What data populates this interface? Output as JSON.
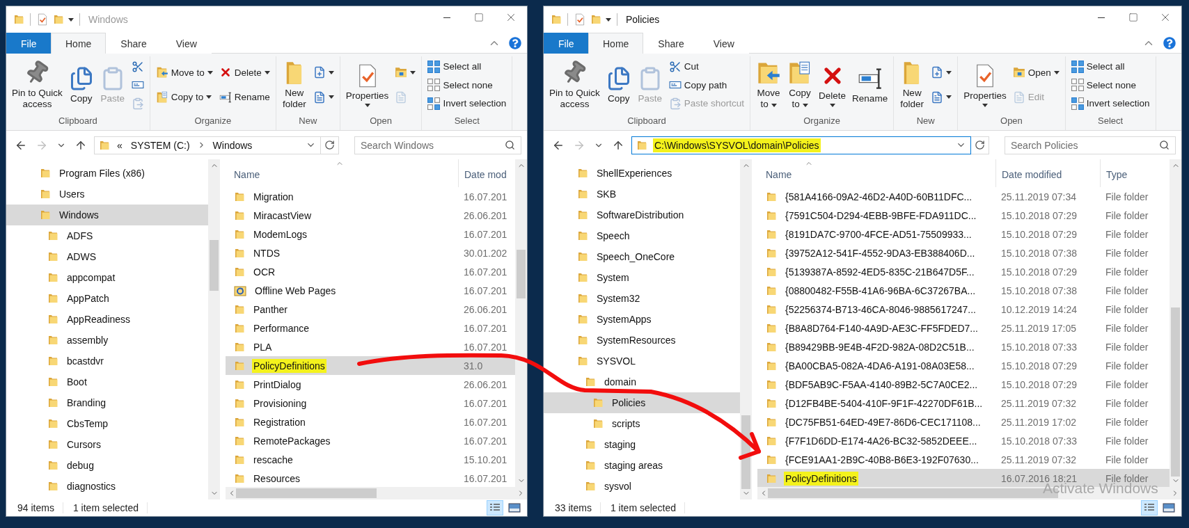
{
  "windows": [
    {
      "title": "Windows",
      "active": false,
      "tabs": [
        {
          "label": "File",
          "kind": "file",
          "selected": false
        },
        {
          "label": "Home",
          "kind": "tab",
          "selected": true
        },
        {
          "label": "Share",
          "kind": "tab",
          "selected": false
        },
        {
          "label": "View",
          "kind": "tab",
          "selected": false
        }
      ],
      "ribbon": [
        {
          "label": "Clipboard",
          "columns": [
            [
              {
                "kind": "pin",
                "label": [
                  "Pin to Quick",
                  "access"
                ],
                "dropdown": false,
                "disabled": false
              }
            ],
            [
              {
                "kind": "copy",
                "label": [
                  "Copy"
                ],
                "dropdown": false,
                "disabled": false
              }
            ],
            [
              {
                "kind": "paste",
                "label": [
                  "Paste"
                ],
                "dropdown": false,
                "disabled": true
              }
            ],
            [
              {
                "kind": "cut",
                "dropdown": false,
                "disabled": false
              },
              {
                "kind": "copypath",
                "dropdown": false,
                "disabled": false
              },
              {
                "kind": "pasteshortcut",
                "dropdown": false,
                "disabled": true
              }
            ]
          ]
        },
        {
          "label": "Organize",
          "columns": [
            [
              {
                "kind": "move",
                "label": [
                  "Move to"
                ],
                "dropdown": true,
                "disabled": false
              },
              {
                "kind": "copyto",
                "label": [
                  "Copy to"
                ],
                "dropdown": true,
                "disabled": false
              }
            ],
            [
              {
                "kind": "delete",
                "label": [
                  "Delete"
                ],
                "dropdown": true,
                "disabled": false
              },
              {
                "kind": "rename",
                "label": [
                  "Rename"
                ],
                "dropdown": false,
                "disabled": false
              }
            ]
          ]
        },
        {
          "label": "New",
          "columns": [
            [
              {
                "kind": "newfolder",
                "label": [
                  "New",
                  "folder"
                ],
                "dropdown": false,
                "disabled": false
              }
            ],
            [
              {
                "kind": "newitem",
                "dropdown": true,
                "disabled": false
              },
              {
                "kind": "easyaccess",
                "dropdown": true,
                "disabled": false
              }
            ]
          ]
        },
        {
          "label": "Open",
          "columns": [
            [
              {
                "kind": "properties",
                "label": [
                  "Properties"
                ],
                "dropdown": true,
                "disabled": false
              }
            ],
            [
              {
                "kind": "open",
                "dropdown": true,
                "disabled": false
              },
              {
                "kind": "edit",
                "dropdown": false,
                "disabled": true
              }
            ]
          ]
        },
        {
          "label": "Select",
          "columns": [
            [
              {
                "kind": "selectall",
                "label": [
                  "Select all"
                ],
                "dropdown": false,
                "disabled": false
              },
              {
                "kind": "selectnone",
                "label": [
                  "Select none"
                ],
                "dropdown": false,
                "disabled": false
              },
              {
                "kind": "invert",
                "label": [
                  "Invert selection"
                ],
                "dropdown": false,
                "disabled": false
              }
            ]
          ]
        }
      ],
      "address": {
        "focused": false,
        "overflow": "«",
        "crumbs": [
          "SYSTEM (C:)",
          "Windows"
        ]
      },
      "search": {
        "placeholder": "Search Windows"
      },
      "nav": [
        {
          "label": "Program Files (x86)",
          "selected": false
        },
        {
          "label": "Users",
          "selected": false
        },
        {
          "label": "Windows",
          "selected": true,
          "children": [
            {
              "label": "ADFS",
              "selected": false
            },
            {
              "label": "ADWS",
              "selected": false
            },
            {
              "label": "appcompat",
              "selected": false
            },
            {
              "label": "AppPatch",
              "selected": false
            },
            {
              "label": "AppReadiness",
              "selected": false
            },
            {
              "label": "assembly",
              "selected": false
            },
            {
              "label": "bcastdvr",
              "selected": false
            },
            {
              "label": "Boot",
              "selected": false
            },
            {
              "label": "Branding",
              "selected": false
            },
            {
              "label": "CbsTemp",
              "selected": false
            },
            {
              "label": "Cursors",
              "selected": false
            },
            {
              "label": "debug",
              "selected": false
            },
            {
              "label": "diagnostics",
              "selected": false
            }
          ]
        }
      ],
      "columns": [
        "Name",
        "Date mod"
      ],
      "rows": [
        {
          "name": "Migration",
          "date": "16.07.201",
          "kind": "folder",
          "selected": false,
          "highlighted": false
        },
        {
          "name": "MiracastView",
          "date": "26.06.201",
          "kind": "folder",
          "selected": false,
          "highlighted": false
        },
        {
          "name": "ModemLogs",
          "date": "16.07.201",
          "kind": "folder",
          "selected": false,
          "highlighted": false
        },
        {
          "name": "NTDS",
          "date": "30.01.202",
          "kind": "folder",
          "selected": false,
          "highlighted": false
        },
        {
          "name": "OCR",
          "date": "16.07.201",
          "kind": "folder",
          "selected": false,
          "highlighted": false
        },
        {
          "name": "Offline Web Pages",
          "date": "16.07.201",
          "kind": "special",
          "selected": false,
          "highlighted": false
        },
        {
          "name": "Panther",
          "date": "26.06.201",
          "kind": "folder",
          "selected": false,
          "highlighted": false
        },
        {
          "name": "Performance",
          "date": "16.07.201",
          "kind": "folder",
          "selected": false,
          "highlighted": false
        },
        {
          "name": "PLA",
          "date": "16.07.201",
          "kind": "folder",
          "selected": false,
          "highlighted": false
        },
        {
          "name": "PolicyDefinitions",
          "date": "31.0",
          "kind": "folder",
          "selected": true,
          "highlighted": true
        },
        {
          "name": "PrintDialog",
          "date": "26.06.201",
          "kind": "folder",
          "selected": false,
          "highlighted": false
        },
        {
          "name": "Provisioning",
          "date": "16.07.201",
          "kind": "folder",
          "selected": false,
          "highlighted": false
        },
        {
          "name": "Registration",
          "date": "16.07.201",
          "kind": "folder",
          "selected": false,
          "highlighted": false
        },
        {
          "name": "RemotePackages",
          "date": "16.07.201",
          "kind": "folder",
          "selected": false,
          "highlighted": false
        },
        {
          "name": "rescache",
          "date": "15.10.201",
          "kind": "folder",
          "selected": false,
          "highlighted": false
        },
        {
          "name": "Resources",
          "date": "16.07.201",
          "kind": "folder",
          "selected": false,
          "highlighted": false
        }
      ],
      "status": {
        "count": "94 items",
        "selection": "1 item selected"
      },
      "views": [
        {
          "kind": "details",
          "selected": true
        },
        {
          "kind": "tiles",
          "selected": false
        }
      ]
    },
    {
      "title": "Policies",
      "active": true,
      "tabs": [
        {
          "label": "File",
          "kind": "file",
          "selected": false
        },
        {
          "label": "Home",
          "kind": "tab",
          "selected": true
        },
        {
          "label": "Share",
          "kind": "tab",
          "selected": false
        },
        {
          "label": "View",
          "kind": "tab",
          "selected": false
        }
      ],
      "ribbon": [
        {
          "label": "Clipboard",
          "columns": [
            [
              {
                "kind": "pin",
                "label": [
                  "Pin to Quick",
                  "access"
                ],
                "dropdown": false,
                "disabled": false
              }
            ],
            [
              {
                "kind": "copy",
                "label": [
                  "Copy"
                ],
                "dropdown": false,
                "disabled": false
              }
            ],
            [
              {
                "kind": "paste",
                "label": [
                  "Paste"
                ],
                "dropdown": false,
                "disabled": true
              }
            ],
            [
              {
                "kind": "cut",
                "label": [
                  "Cut"
                ],
                "dropdown": false,
                "disabled": false
              },
              {
                "kind": "copypath",
                "label": [
                  "Copy path"
                ],
                "dropdown": false,
                "disabled": false
              },
              {
                "kind": "pasteshortcut",
                "label": [
                  "Paste shortcut"
                ],
                "dropdown": false,
                "disabled": true
              }
            ]
          ]
        },
        {
          "label": "Organize",
          "columns": [
            [
              {
                "kind": "move",
                "label": [
                  "Move",
                  "to"
                ],
                "dropdown": true,
                "disabled": false
              }
            ],
            [
              {
                "kind": "copyto",
                "label": [
                  "Copy",
                  "to"
                ],
                "dropdown": true,
                "disabled": false
              }
            ],
            [
              {
                "kind": "delete",
                "label": [
                  "Delete"
                ],
                "dropdown": true,
                "disabled": false
              }
            ],
            [
              {
                "kind": "rename",
                "label": [
                  "Rename"
                ],
                "dropdown": false,
                "disabled": false
              }
            ]
          ]
        },
        {
          "label": "New",
          "columns": [
            [
              {
                "kind": "newfolder",
                "label": [
                  "New",
                  "folder"
                ],
                "dropdown": false,
                "disabled": false
              }
            ],
            [
              {
                "kind": "newitem",
                "dropdown": true,
                "disabled": false
              },
              {
                "kind": "easyaccess",
                "dropdown": true,
                "disabled": false
              }
            ]
          ]
        },
        {
          "label": "Open",
          "columns": [
            [
              {
                "kind": "properties",
                "label": [
                  "Properties"
                ],
                "dropdown": true,
                "disabled": false
              }
            ],
            [
              {
                "kind": "open",
                "label": [
                  "Open"
                ],
                "dropdown": true,
                "disabled": false
              },
              {
                "kind": "edit",
                "label": [
                  "Edit"
                ],
                "dropdown": false,
                "disabled": true
              }
            ]
          ]
        },
        {
          "label": "Select",
          "columns": [
            [
              {
                "kind": "selectall",
                "label": [
                  "Select all"
                ],
                "dropdown": false,
                "disabled": false
              },
              {
                "kind": "selectnone",
                "label": [
                  "Select none"
                ],
                "dropdown": false,
                "disabled": false
              },
              {
                "kind": "invert",
                "label": [
                  "Invert selection"
                ],
                "dropdown": false,
                "disabled": false
              }
            ]
          ]
        }
      ],
      "address": {
        "focused": true,
        "path": "C:\\Windows\\SYSVOL\\domain\\Policies",
        "highlighted": true
      },
      "search": {
        "placeholder": "Search Policies"
      },
      "nav": [
        {
          "label": "ShellExperiences",
          "selected": false
        },
        {
          "label": "SKB",
          "selected": false
        },
        {
          "label": "SoftwareDistribution",
          "selected": false
        },
        {
          "label": "Speech",
          "selected": false
        },
        {
          "label": "Speech_OneCore",
          "selected": false
        },
        {
          "label": "System",
          "selected": false
        },
        {
          "label": "System32",
          "selected": false
        },
        {
          "label": "SystemApps",
          "selected": false
        },
        {
          "label": "SystemResources",
          "selected": false
        },
        {
          "label": "SYSVOL",
          "selected": false,
          "children": [
            {
              "label": "domain",
              "selected": false,
              "children": [
                {
                  "label": "Policies",
                  "selected": true
                },
                {
                  "label": "scripts",
                  "selected": false
                }
              ]
            },
            {
              "label": "staging",
              "selected": false
            },
            {
              "label": "staging areas",
              "selected": false
            },
            {
              "label": "sysvol",
              "selected": false
            }
          ]
        }
      ],
      "columns": [
        "Name",
        "Date modified",
        "Type"
      ],
      "rows": [
        {
          "name": "{581A4166-09A2-46D2-A40D-60B11DFC...",
          "date": "25.11.2019 07:34",
          "type": "File folder",
          "kind": "folder",
          "selected": false,
          "highlighted": false
        },
        {
          "name": "{7591C504-D294-4EBB-9BFE-FDA911DC...",
          "date": "15.10.2018 07:29",
          "type": "File folder",
          "kind": "folder",
          "selected": false,
          "highlighted": false
        },
        {
          "name": "{8191DA7C-9700-4FCE-AD51-75509933...",
          "date": "15.10.2018 07:29",
          "type": "File folder",
          "kind": "folder",
          "selected": false,
          "highlighted": false
        },
        {
          "name": "{39752A12-541F-4552-9DA3-EB388406D...",
          "date": "15.10.2018 07:38",
          "type": "File folder",
          "kind": "folder",
          "selected": false,
          "highlighted": false
        },
        {
          "name": "{5139387A-8592-4ED5-835C-21B647D5F...",
          "date": "15.10.2018 07:29",
          "type": "File folder",
          "kind": "folder",
          "selected": false,
          "highlighted": false
        },
        {
          "name": "{08800482-F55B-41A6-96BA-6C37267BA...",
          "date": "15.10.2018 07:38",
          "type": "File folder",
          "kind": "folder",
          "selected": false,
          "highlighted": false
        },
        {
          "name": "{52256374-B713-46CA-8046-9885617247...",
          "date": "10.12.2019 14:24",
          "type": "File folder",
          "kind": "folder",
          "selected": false,
          "highlighted": false
        },
        {
          "name": "{B8A8D764-F140-4A9D-AE3C-FF5FDED7...",
          "date": "25.11.2019 17:05",
          "type": "File folder",
          "kind": "folder",
          "selected": false,
          "highlighted": false
        },
        {
          "name": "{B89429BB-9E4B-4F2D-982A-08D2C51B...",
          "date": "15.10.2018 07:33",
          "type": "File folder",
          "kind": "folder",
          "selected": false,
          "highlighted": false
        },
        {
          "name": "{BA00CBA5-082A-4DA6-A191-08A03E58...",
          "date": "15.10.2018 07:29",
          "type": "File folder",
          "kind": "folder",
          "selected": false,
          "highlighted": false
        },
        {
          "name": "{BDF5AB9C-F5AA-4140-89B2-5C7A0CE2...",
          "date": "15.10.2018 07:29",
          "type": "File folder",
          "kind": "folder",
          "selected": false,
          "highlighted": false
        },
        {
          "name": "{D12FB4BE-5404-410F-9F1F-42270DF61B...",
          "date": "25.11.2019 07:32",
          "type": "File folder",
          "kind": "folder",
          "selected": false,
          "highlighted": false
        },
        {
          "name": "{DC75FB51-64ED-49E7-86D6-CEC171108...",
          "date": "25.11.2019 17:02",
          "type": "File folder",
          "kind": "folder",
          "selected": false,
          "highlighted": false
        },
        {
          "name": "{F7F1D6DD-E174-4A26-BC32-5852DEEE...",
          "date": "15.10.2018 07:33",
          "type": "File folder",
          "kind": "folder",
          "selected": false,
          "highlighted": false
        },
        {
          "name": "{FCE91AA1-2B9C-40B8-B6E3-192F07630...",
          "date": "25.11.2019 07:32",
          "type": "File folder",
          "kind": "folder",
          "selected": false,
          "highlighted": false
        },
        {
          "name": "PolicyDefinitions",
          "date": "16.07.2016 18:21",
          "type": "File folder",
          "kind": "folder",
          "selected": true,
          "highlighted": true
        }
      ],
      "status": {
        "count": "33 items",
        "selection": "1 item selected"
      },
      "views": [
        {
          "kind": "details",
          "selected": true
        },
        {
          "kind": "tiles",
          "selected": false
        }
      ]
    }
  ],
  "activation_notice": "Activate Windows"
}
